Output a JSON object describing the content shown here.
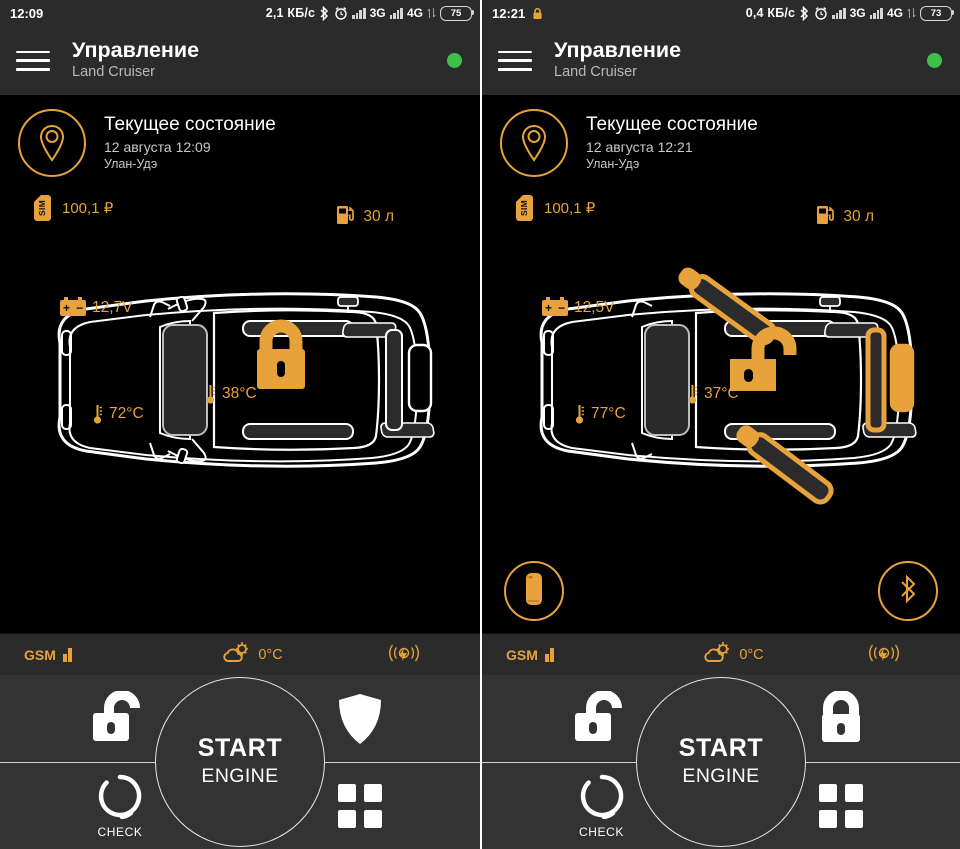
{
  "accent": "#e8a23c",
  "green": "#3fbf47",
  "bar_bg": "#2b2b2b",
  "action_bg": "#333333",
  "panels": [
    {
      "id": "left",
      "status": {
        "time": "12:09",
        "lock_icon": "",
        "speed": "2,1 КБ/с",
        "bluetooth_icon": "bluetooth-icon",
        "alarm_icon": "alarm-clock-icon",
        "net1": "3G",
        "net2": "4G",
        "battery": "75"
      },
      "header": {
        "menu_icon": "hamburger-menu-icon",
        "title": "Управление",
        "subtitle": "Land Cruiser",
        "status_dot": "online-indicator"
      },
      "state": {
        "pin_icon": "map-pin-icon",
        "title": "Текущее состояние",
        "date": "12 августа 12:09",
        "city": "Улан-Удэ"
      },
      "sim": {
        "icon_label": "SIM",
        "balance": "100,1 ₽"
      },
      "fuel": {
        "icon": "fuel-pump-icon",
        "value": "30 л"
      },
      "car": {
        "battery_voltage": "12,7V",
        "engine_temp": "72°C",
        "cabin_temp": "38°C",
        "lock_state": "locked",
        "doors_open": [],
        "trunk_open": false,
        "hazard_on": false
      },
      "quick_buttons": [],
      "gsm": {
        "label": "GSM",
        "signal_icon": "gsm-signal-icon",
        "weather_icon": "partly-cloudy-icon",
        "weather_temp": "0°C",
        "sensor_icon": "shock-sensor-icon"
      },
      "actions": {
        "top_left": {
          "name": "unlock-doors-button",
          "icon": "unlock-icon"
        },
        "top_right": {
          "name": "guard-mode-button",
          "icon": "shield-icon"
        },
        "bottom_left": {
          "name": "check-status-button",
          "icon": "refresh-circle-icon",
          "label": "CHECK"
        },
        "bottom_right": {
          "name": "more-apps-button",
          "icon": "grid-icon"
        },
        "center": {
          "name": "start-engine-button",
          "line1": "START",
          "line2": "ENGINE"
        }
      }
    },
    {
      "id": "right",
      "status": {
        "time": "12:21",
        "lock_icon": "screen-lock-icon",
        "speed": "0,4 КБ/с",
        "bluetooth_icon": "bluetooth-icon",
        "alarm_icon": "alarm-clock-icon",
        "net1": "3G",
        "net2": "4G",
        "battery": "73"
      },
      "header": {
        "menu_icon": "hamburger-menu-icon",
        "title": "Управление",
        "subtitle": "Land Cruiser",
        "status_dot": "online-indicator"
      },
      "state": {
        "pin_icon": "map-pin-icon",
        "title": "Текущее состояние",
        "date": "12 августа 12:21",
        "city": "Улан-Удэ"
      },
      "sim": {
        "icon_label": "SIM",
        "balance": "100,1 ₽"
      },
      "fuel": {
        "icon": "fuel-pump-icon",
        "value": "30 л"
      },
      "car": {
        "battery_voltage": "12,5V",
        "engine_temp": "77°C",
        "cabin_temp": "37°C",
        "lock_state": "unlocked",
        "doors_open": [
          "front-left",
          "rear-left"
        ],
        "trunk_open": true,
        "hazard_on": false
      },
      "quick_buttons": [
        {
          "name": "key-fob-button",
          "icon": "key-fob-icon"
        },
        {
          "name": "bluetooth-button",
          "icon": "bluetooth-icon"
        }
      ],
      "gsm": {
        "label": "GSM",
        "signal_icon": "gsm-signal-icon",
        "weather_icon": "partly-cloudy-icon",
        "weather_temp": "0°C",
        "sensor_icon": "shock-sensor-icon"
      },
      "actions": {
        "top_left": {
          "name": "unlock-doors-button",
          "icon": "unlock-icon"
        },
        "top_right": {
          "name": "lock-doors-button",
          "icon": "lock-icon"
        },
        "bottom_left": {
          "name": "check-status-button",
          "icon": "refresh-circle-icon",
          "label": "CHECK"
        },
        "bottom_right": {
          "name": "more-apps-button",
          "icon": "grid-icon"
        },
        "center": {
          "name": "start-engine-button",
          "line1": "START",
          "line2": "ENGINE"
        }
      }
    }
  ]
}
